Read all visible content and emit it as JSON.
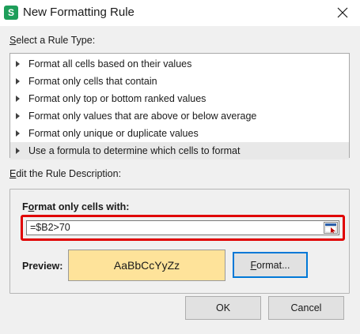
{
  "window": {
    "app_icon_letter": "S",
    "title": "New Formatting Rule",
    "close_symbol": "✕"
  },
  "rule_type": {
    "label_accel": "S",
    "label_rest": "elect a Rule Type:",
    "items": [
      {
        "label": "Format all cells based on their values",
        "selected": false
      },
      {
        "label": "Format only cells that contain",
        "selected": false
      },
      {
        "label": "Format only top or bottom ranked values",
        "selected": false
      },
      {
        "label": "Format only values that are above or below average",
        "selected": false
      },
      {
        "label": "Format only unique or duplicate values",
        "selected": false
      },
      {
        "label": "Use a formula to determine which cells to format",
        "selected": true
      }
    ]
  },
  "description": {
    "label_accel": "E",
    "label_rest": "dit the Rule Description:",
    "heading_accel": "o",
    "heading_pre": "F",
    "heading_rest": "rmat only cells with:",
    "formula_value": "=$B2>70",
    "highlight_color": "#e00000",
    "preview_label": "Preview:",
    "preview_text": "AaBbCcYyZz",
    "preview_fill": "#fee39a",
    "format_button_accel": "F",
    "format_button_rest": "ormat..."
  },
  "buttons": {
    "ok": "OK",
    "cancel": "Cancel"
  },
  "icons": {
    "app": "app-logo-icon",
    "close": "close-icon",
    "range": "range-picker-icon",
    "arrow": "triangle-right-icon"
  }
}
